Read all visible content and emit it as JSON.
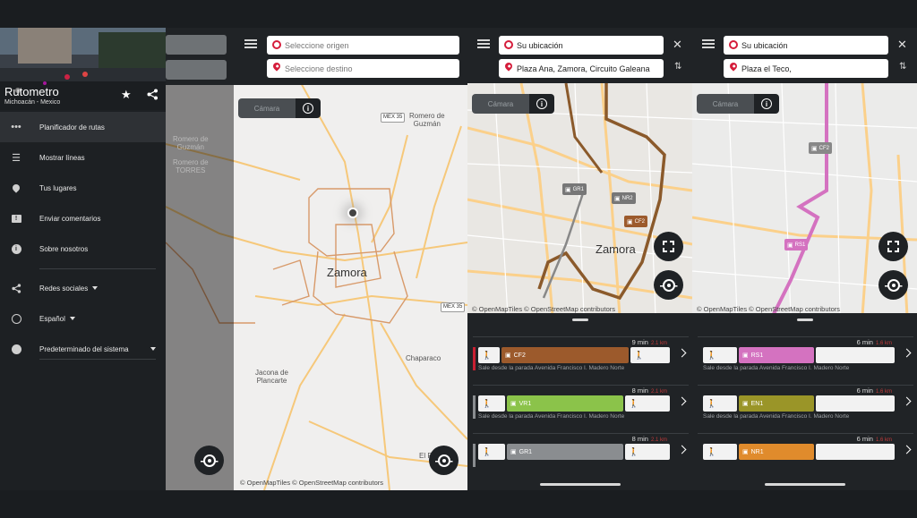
{
  "drawer": {
    "app_title": "Rutometro",
    "app_subtitle": "Michoacán - Mexico",
    "menu": [
      {
        "label": "Planificador de rutas",
        "icon": "route-dots-icon"
      },
      {
        "label": "Mostrar líneas",
        "icon": "list-icon"
      },
      {
        "label": "Tus lugares",
        "icon": "location-pin-icon"
      },
      {
        "label": "Enviar comentarios",
        "icon": "feedback-icon"
      },
      {
        "label": "Sobre nosotros",
        "icon": "info-icon"
      }
    ],
    "settings": [
      {
        "label": "Redes sociales",
        "icon": "share-icon"
      },
      {
        "label": "Español",
        "icon": "globe-icon"
      },
      {
        "label": "Predeterminado del sistema",
        "icon": "palette-icon"
      }
    ]
  },
  "planner": {
    "origin_placeholder": "Seleccione origen",
    "destination_placeholder": "Seleccione destino",
    "camera_label": "Cámara",
    "city": "Zamora",
    "places": [
      "Romero de\nGuzmán",
      "Romero de\nTORRES",
      "Jacona de\nPlancarte",
      "Chaparaco",
      "El P"
    ],
    "attribution": "© OpenMapTiles © OpenStreetMap contributors"
  },
  "screen3": {
    "origin": "Su ubicación",
    "destination": "Plaza Ana, Zamora, Circuito Galeana",
    "camera_label": "Cámara",
    "city": "Zamora",
    "stops": [
      "GR1",
      "NR2",
      "CF2"
    ],
    "attribution": "© OpenMapTiles © OpenStreetMap contributors",
    "routes": [
      {
        "time": "9 min",
        "dist": "2.1 km",
        "line": "CF2",
        "color": "#9c5a2c",
        "desc": "Sale desde la parada Avenida Francisco I. Madero Norte"
      },
      {
        "time": "8 min",
        "dist": "2.1 km",
        "line": "VR1",
        "color": "#8bc34a",
        "desc": "Sale desde la parada Avenida Francisco I. Madero Norte"
      },
      {
        "time": "8 min",
        "dist": "2.1 km",
        "line": "GR1",
        "color": "#8a8d90",
        "desc": ""
      }
    ]
  },
  "screen4": {
    "origin": "Su ubicación",
    "destination": "Plaza el Teco,",
    "camera_label": "Cámara",
    "stops": [
      "CF2",
      "RS1"
    ],
    "attribution": "© OpenMapTiles © OpenStreetMap contributors",
    "routes": [
      {
        "time": "6 min",
        "dist": "1.6 km",
        "line": "RS1",
        "color": "#d472c0",
        "desc": "Sale desde la parada Avenida Francisco I. Madero Norte"
      },
      {
        "time": "6 min",
        "dist": "1.6 km",
        "line": "EN1",
        "color": "#9a9528",
        "desc": "Sale desde la parada Avenida Francisco I. Madero Norte"
      },
      {
        "time": "6 min",
        "dist": "1.6 km",
        "line": "NR1",
        "color": "#e08b2c",
        "desc": ""
      }
    ]
  }
}
